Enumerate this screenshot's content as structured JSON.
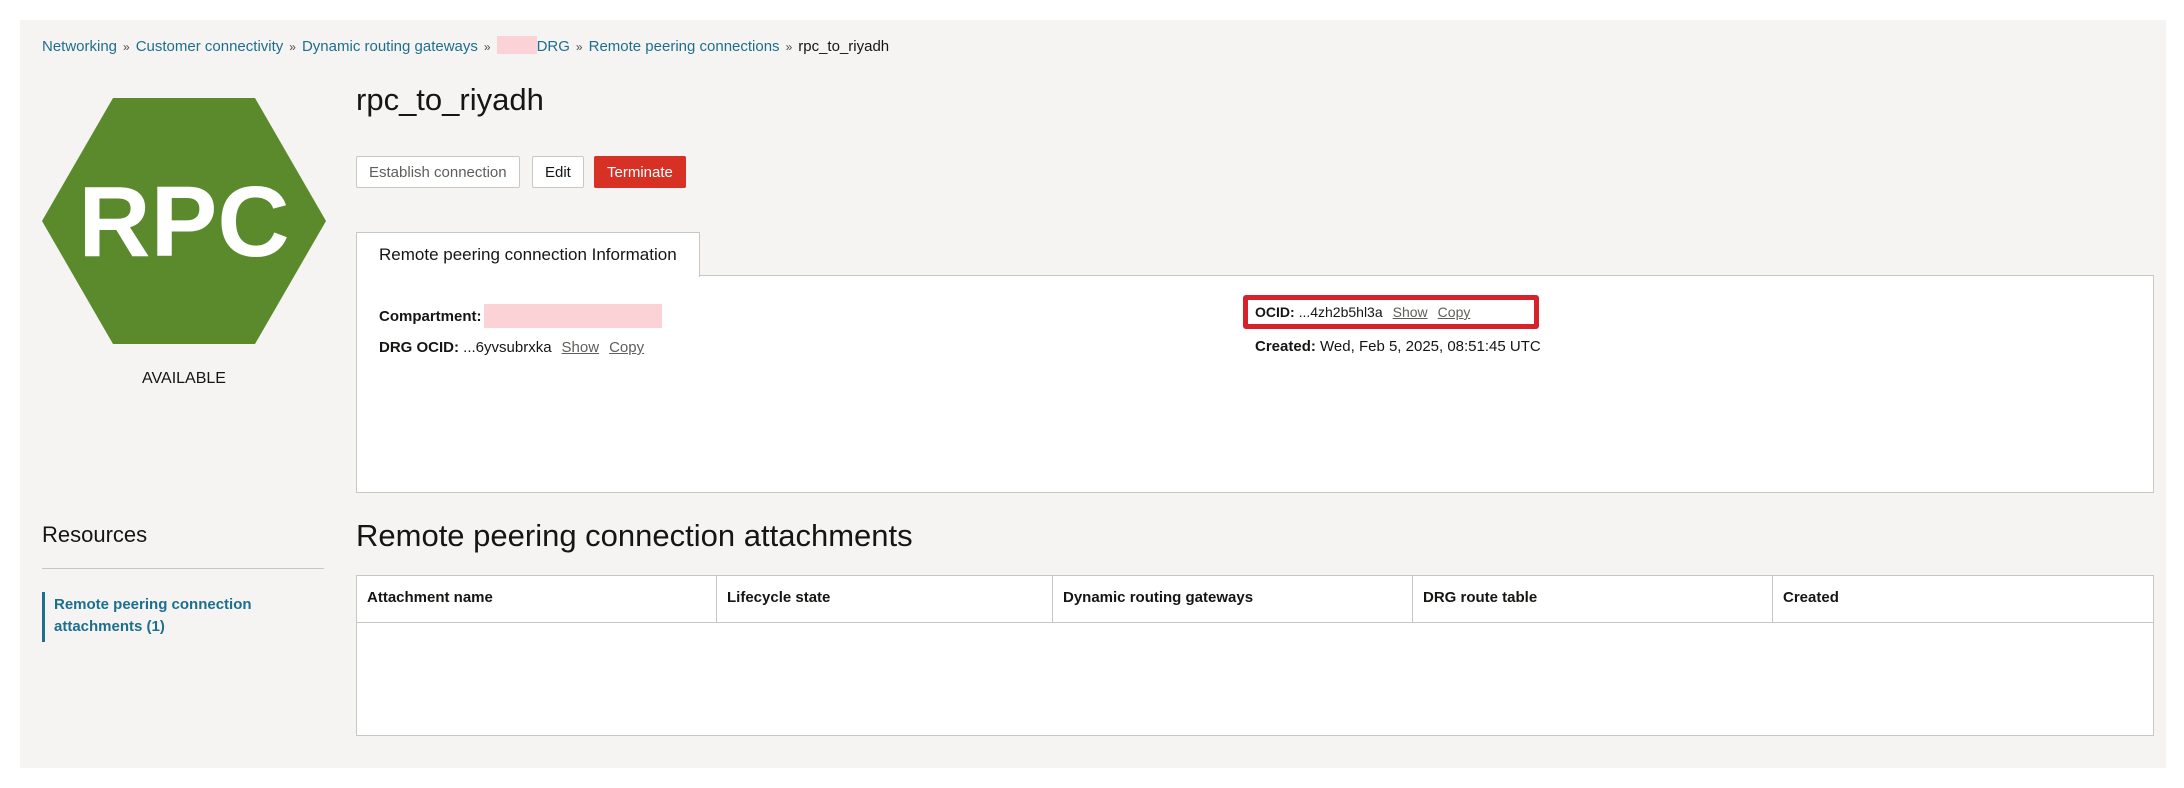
{
  "breadcrumb": {
    "items": [
      "Networking",
      "Customer connectivity",
      "Dynamic routing gateways",
      "DRG",
      "Remote peering connections"
    ],
    "current": "rpc_to_riyadh"
  },
  "resource": {
    "icon_text": "RPC",
    "status": "AVAILABLE",
    "title": "rpc_to_riyadh",
    "icon_color": "#5a8a2c"
  },
  "actions": {
    "establish": "Establish connection",
    "edit": "Edit",
    "terminate": "Terminate"
  },
  "info_tab": {
    "label": "Remote peering connection Information",
    "compartment_label": "Compartment:",
    "drg_ocid_label": "DRG OCID:",
    "drg_ocid_value": "...6yvsubrxka",
    "ocid_label": "OCID:",
    "ocid_value": "...4zh2b5hl3a",
    "created_label": "Created:",
    "created_value": "Wed, Feb 5, 2025, 08:51:45 UTC",
    "show": "Show",
    "copy": "Copy"
  },
  "resources": {
    "heading": "Resources",
    "item": "Remote peering connection attachments (1)"
  },
  "attachments": {
    "heading": "Remote peering connection attachments",
    "columns": [
      "Attachment name",
      "Lifecycle state",
      "Dynamic routing gateways",
      "DRG route table",
      "Created"
    ]
  }
}
